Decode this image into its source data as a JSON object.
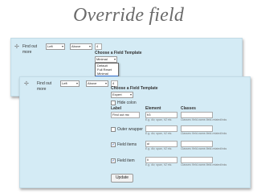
{
  "slide": {
    "title": "Override field"
  },
  "row1": {
    "handle": "✢",
    "field_label_line1": "Find out",
    "field_label_line2": "more",
    "label_position": "Left",
    "label_position_2": "Above",
    "weight": "4",
    "template_heading": "Choose a Field Template",
    "template_value": "Minimal",
    "template_options": [
      "Default",
      "Full Reset",
      "Minimal",
      "Expert"
    ],
    "template_selected": "Expert"
  },
  "row2": {
    "handle": "✢",
    "field_label_line1": "Find out",
    "field_label_line2": "more",
    "label_position": "Left",
    "label_position_2": "Above",
    "weight": "4",
    "template_heading": "Choose a Field Template",
    "template_value": "Expert",
    "hide_colon": "Hide colon",
    "col_label": "Label",
    "col_element": "Element",
    "col_classes": "Classes",
    "label_value": "Find out mc",
    "label_element": "h3",
    "element_hint": "E.g. div, span, h2 etc.",
    "classes_hint": "Classes: field-name-field-relatedlinks",
    "outer_wrapper": "Outer wrapper",
    "outer_hint": "E.g. div, span, h2 etc.",
    "outer_classes_hint": "Classes: field-name-field-relatedlinks",
    "field_items": "Field items",
    "field_items_element": "ul",
    "field_items_hint": "E.g. div, span, h2 etc.",
    "field_items_classes_hint": "Classes: field-name-field-relatedlinks",
    "field_item": "Field item",
    "field_item_element": "li",
    "field_item_hint": "E.g. div, span, h2 etc.",
    "field_item_classes_hint": "Classes: field-name-field-relatedlinks",
    "update_button": "Update"
  }
}
